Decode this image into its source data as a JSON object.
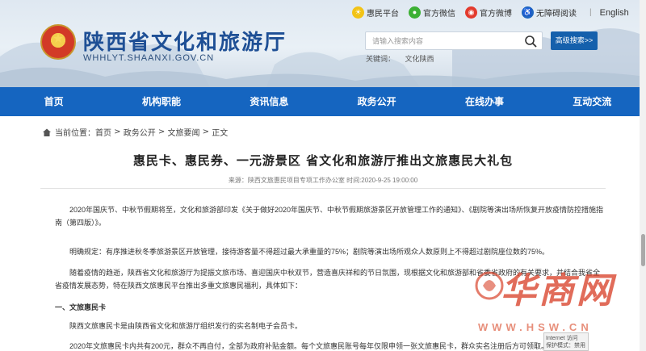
{
  "header": {
    "site_title": "陕西省文化和旅游厅",
    "site_domain": "WHHLYT.SHAANXI.GOV.CN",
    "toplinks": [
      {
        "label": "惠民平台",
        "icon": "sun-icon",
        "color": "#f2c316"
      },
      {
        "label": "官方微信",
        "icon": "wechat-icon",
        "color": "#3cb034"
      },
      {
        "label": "官方微博",
        "icon": "weibo-icon",
        "color": "#e33b2e"
      },
      {
        "label": "无障碍阅读",
        "icon": "accessibility-icon",
        "color": "#1f66c1"
      }
    ],
    "english": "English",
    "search_placeholder": "请输入搜索内容",
    "advanced_search": "高级搜索>>",
    "keywords_label": "关键词：",
    "keywords": [
      "文化陕西"
    ]
  },
  "nav": [
    "首页",
    "机构职能",
    "资讯信息",
    "政务公开",
    "在线办事",
    "互动交流"
  ],
  "breadcrumb": {
    "label": "当前位置：",
    "items": [
      "首页",
      "政务公开",
      "文旅要闻",
      "正文"
    ],
    "separator": " > "
  },
  "article": {
    "title": "惠民卡、惠民券、一元游景区 省文化和旅游厅推出文旅惠民大礼包",
    "meta": "来源：陕西文旅惠民项目专项工作办公室 时间:2020-9-25 19:00:00",
    "p1": "2020年国庆节、中秋节假期将至，文化和旅游部印发《关于做好2020年国庆节、中秋节假期旅游景区开放管理工作的通知》、《剧院等演出场所恢复开放疫情防控措施指南（第四版）》。",
    "p2": "明确规定：有序推进秋冬季旅游景区开放管理，接待游客量不得超过最大承重量的75%；剧院等演出场所观众人数原则上不得超过剧院座位数的75%。",
    "p3": "随着疫情的趋逝，陕西省文化和旅游厅为提振文旅市场、喜迎国庆中秋双节，营造喜庆祥和的节日氛围，现根据文化和旅游部和省委省政府的有关要求，并结合我省全省疫情发展态势，特在陕西文旅惠民平台推出多重文旅惠民福利，具体如下：",
    "section1": "一、文旅惠民卡",
    "p4": "陕西文旅惠民卡是由陕西省文化和旅游厅组织发行的实名制电子会员卡。",
    "p5": "2020年文旅惠民卡内共有200元，群众不再自付，全部为政府补贴金额。每个文旅惠民账号每年仅限申领一张文旅惠民卡，群众实名注册后方可领取。"
  },
  "watermark": {
    "logo_text": "华商网",
    "url": "WWW.HSW.CN"
  },
  "tooltip": {
    "line1": "Internet 访问",
    "line2": "保护模式：禁用"
  },
  "colors": {
    "nav_bg": "#1565c0",
    "title_blue": "#1e4f95",
    "adv_search_bg": "#1560ac"
  }
}
